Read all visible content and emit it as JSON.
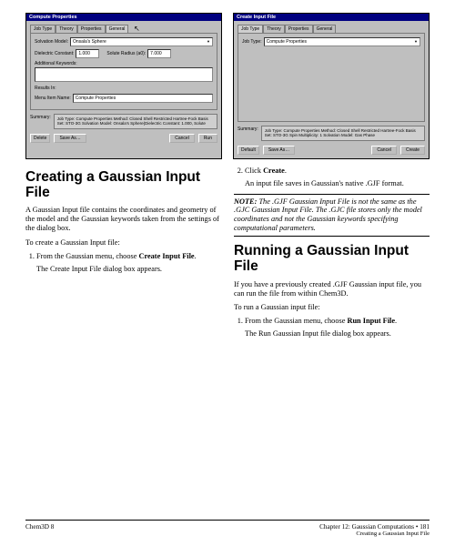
{
  "figures": {
    "dialog1": {
      "title": "Compute Properties",
      "tabs": [
        "Job Type",
        "Theory",
        "Properties",
        "General"
      ],
      "active_tab": 3,
      "solvation_model_label": "Solvation Model:",
      "solvation_model_value": "Onsala's Sphere",
      "dielectric_label": "Dielectric Constant:",
      "dielectric_value": "1.000",
      "solute_radius_label": "Solute Radius (a0):",
      "solute_radius_value": "7.000",
      "keywords_label": "Additional Keywords:",
      "resultsin_label": "Results In:",
      "runname_label": "Menu Item Name:",
      "runname_value": "Compute Properties",
      "summary_label": "Summary:",
      "summary_text": "Job Type: Compute Properties\nMethod: Closed Shell Restricted Hartree-Fock\nBasis Set: STO-3G\nSolvation Model: Onsala's Sphere(Dielectric Constant: 1.000, Solute",
      "buttons": {
        "delete": "Delete",
        "saveas": "Save As…",
        "cancel": "Cancel",
        "run": "Run"
      }
    },
    "dialog2": {
      "title": "Create Input File",
      "tabs": [
        "Job Type",
        "Theory",
        "Properties",
        "General"
      ],
      "active_tab": 0,
      "jobtype_label": "Job Type:",
      "jobtype_value": "Compute Properties",
      "summary_label": "Summary:",
      "summary_text": "Job Type: Compute Properties\nMethod: Closed Shell Restricted Hartree-Fock\nBasis Set: STO-3G\nSpin Multiplicity: 1\nSolvation Model: Gas Phase",
      "buttons": {
        "default": "Default",
        "saveas": "Save As…",
        "cancel": "Cancel",
        "create": "Create"
      }
    }
  },
  "left": {
    "h1": "Creating a Gaussian Input File",
    "p1": "A Gaussian Input file contains the coordinates and geometry of the model and the Gaussian keywords taken from the settings of the dialog box.",
    "p2": "To create a Gaussian Input file:",
    "step1": "From the Gaussian menu, choose Create Input File.",
    "step1_sub": "The Create Input File dialog box appears."
  },
  "right": {
    "step2": "Click Create.",
    "step2_sub": "An input file saves in Gaussian's native .GJF format.",
    "note": "NOTE: The .GJF Gaussian Input File is not the same as the .GJC Gaussian Input File. The .GJC file stores only the model coordinates and not the Gaussian keywords specifying computational parameters.",
    "h1": "Running a Gaussian Input File",
    "p1": "If you have a previously created .GJF Gaussian input file, you can run the file from within Chem3D.",
    "p2": "To run a Gaussian input file:",
    "step1": "From the Gaussian menu, choose Run Input File.",
    "step1_sub": "The Run Gaussian Input file dialog box appears."
  },
  "footer": {
    "left": "Chem3D 8",
    "right1": "Chapter 12: Gaussian Computations    •   181",
    "right2": "Creating a Gaussian Input File"
  }
}
